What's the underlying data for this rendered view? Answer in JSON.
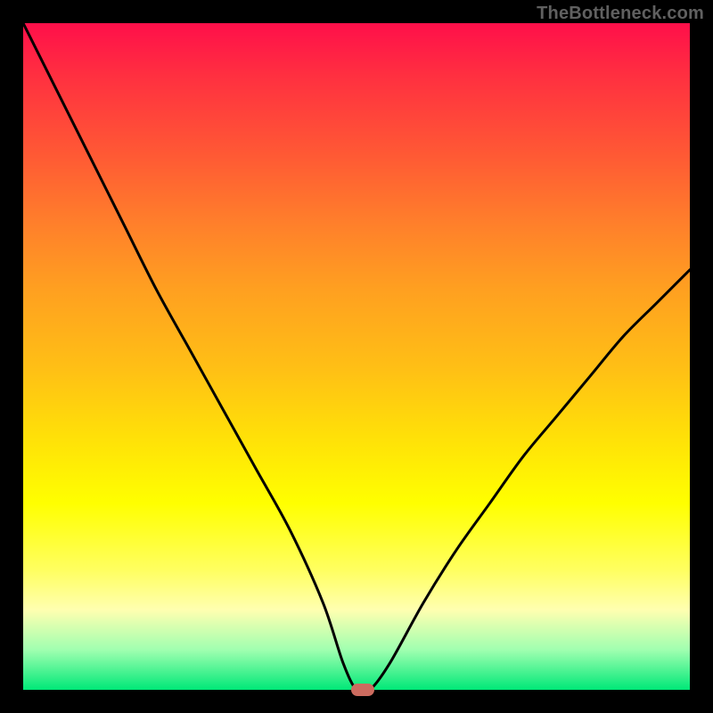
{
  "watermark": "TheBottleneck.com",
  "chart_data": {
    "type": "line",
    "title": "",
    "xlabel": "",
    "ylabel": "",
    "xlim": [
      0,
      100
    ],
    "ylim": [
      0,
      100
    ],
    "x": [
      0,
      5,
      10,
      15,
      20,
      25,
      30,
      35,
      40,
      45,
      48,
      50,
      52,
      55,
      60,
      65,
      70,
      75,
      80,
      85,
      90,
      95,
      100
    ],
    "y": [
      100,
      90,
      80,
      70,
      60,
      51,
      42,
      33,
      24,
      13,
      4,
      0,
      0,
      4,
      13,
      21,
      28,
      35,
      41,
      47,
      53,
      58,
      63
    ],
    "marker": {
      "x": 51,
      "y": 0
    },
    "background_gradient": {
      "top": "#ff0f4a",
      "mid": "#ffff00",
      "bottom": "#00e878"
    }
  }
}
